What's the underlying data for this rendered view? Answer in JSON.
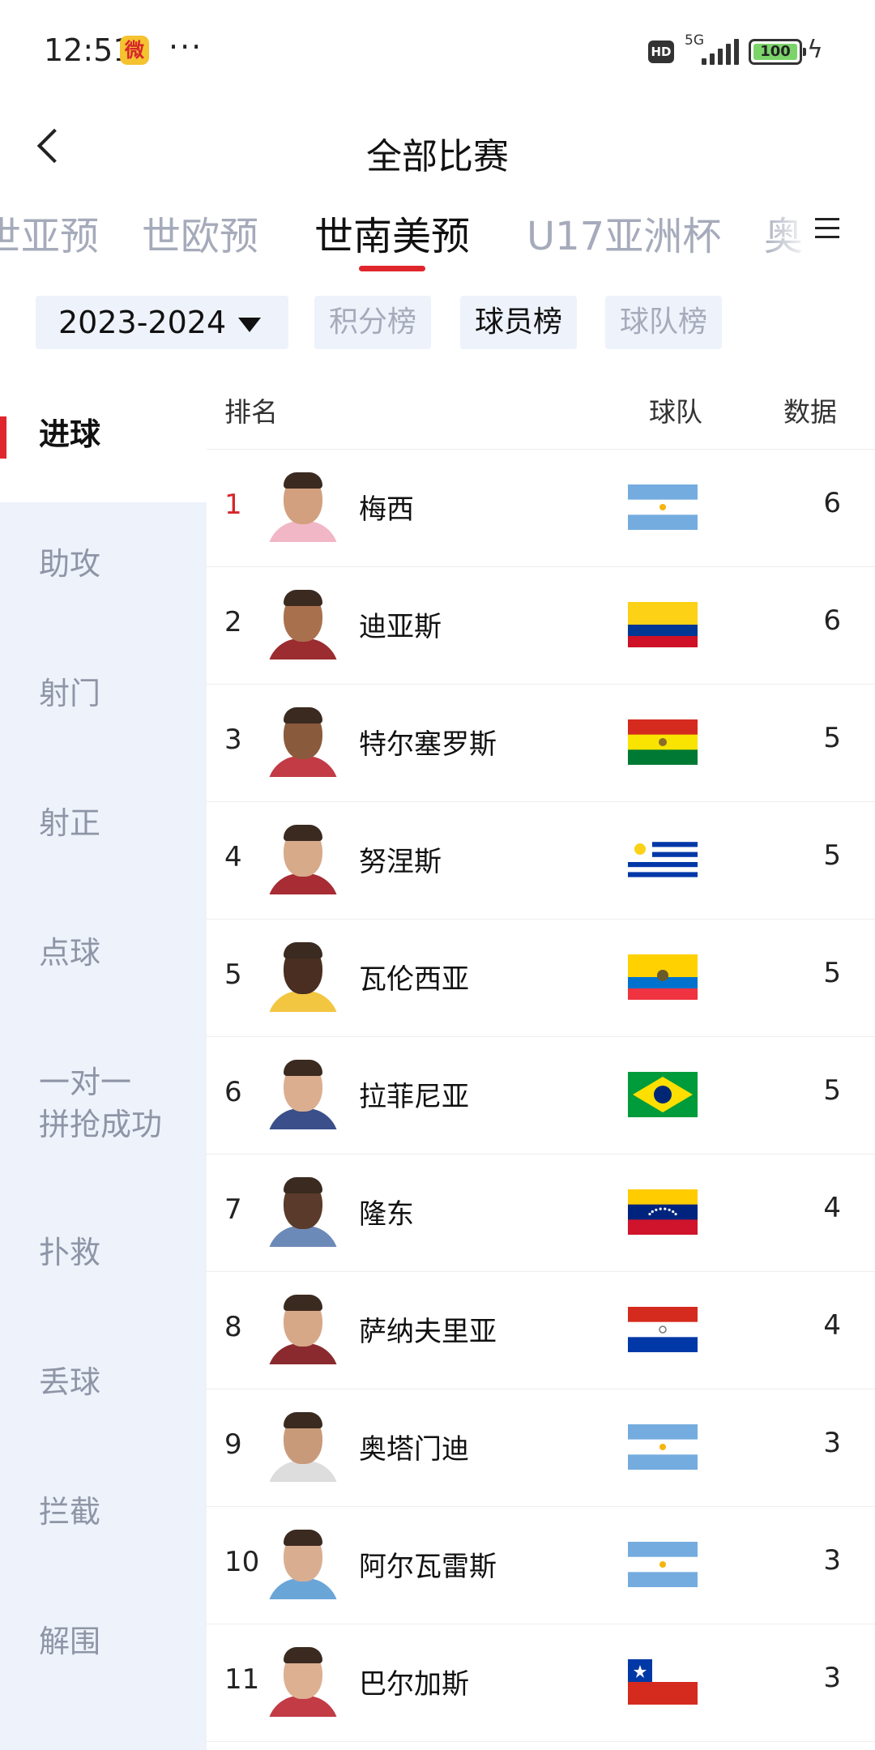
{
  "status_bar": {
    "time": "12:51",
    "weibo_icon_text": "微",
    "more": "···",
    "hd": "HD",
    "network": "5G",
    "battery": "100"
  },
  "header": {
    "title": "全部比赛"
  },
  "tabs": [
    "世亚预",
    "世欧预",
    "世南美预",
    "U17亚洲杯",
    "奥"
  ],
  "active_tab": "世南美预",
  "filters": {
    "season": "2023-2024",
    "pills": [
      "积分榜",
      "球员榜",
      "球队榜"
    ],
    "active_pill": "球员榜"
  },
  "sidebar": {
    "active": "进球",
    "items": [
      "助攻",
      "射门",
      "射正",
      "点球",
      "一对一\n拼抢成功",
      "扑救",
      "丢球",
      "拦截",
      "解围"
    ]
  },
  "table": {
    "headers": {
      "rank": "排名",
      "team": "球队",
      "data": "数据"
    },
    "rows": [
      {
        "rank": "1",
        "name": "梅西",
        "team": "argentina",
        "value": "6"
      },
      {
        "rank": "2",
        "name": "迪亚斯",
        "team": "colombia",
        "value": "6"
      },
      {
        "rank": "3",
        "name": "特尔塞罗斯",
        "team": "bolivia",
        "value": "5"
      },
      {
        "rank": "4",
        "name": "努涅斯",
        "team": "uruguay",
        "value": "5"
      },
      {
        "rank": "5",
        "name": "瓦伦西亚",
        "team": "ecuador",
        "value": "5"
      },
      {
        "rank": "6",
        "name": "拉菲尼亚",
        "team": "brazil",
        "value": "5"
      },
      {
        "rank": "7",
        "name": "隆东",
        "team": "venezuela",
        "value": "4"
      },
      {
        "rank": "8",
        "name": "萨纳夫里亚",
        "team": "paraguay",
        "value": "4"
      },
      {
        "rank": "9",
        "name": "奥塔门迪",
        "team": "argentina",
        "value": "3"
      },
      {
        "rank": "10",
        "name": "阿尔瓦雷斯",
        "team": "argentina",
        "value": "3"
      },
      {
        "rank": "11",
        "name": "巴尔加斯",
        "team": "chile",
        "value": "3"
      }
    ]
  },
  "colors": {
    "accent": "#e0262d",
    "sidebar_bg": "#eef2fb",
    "inactive_text": "#a6abbb"
  }
}
